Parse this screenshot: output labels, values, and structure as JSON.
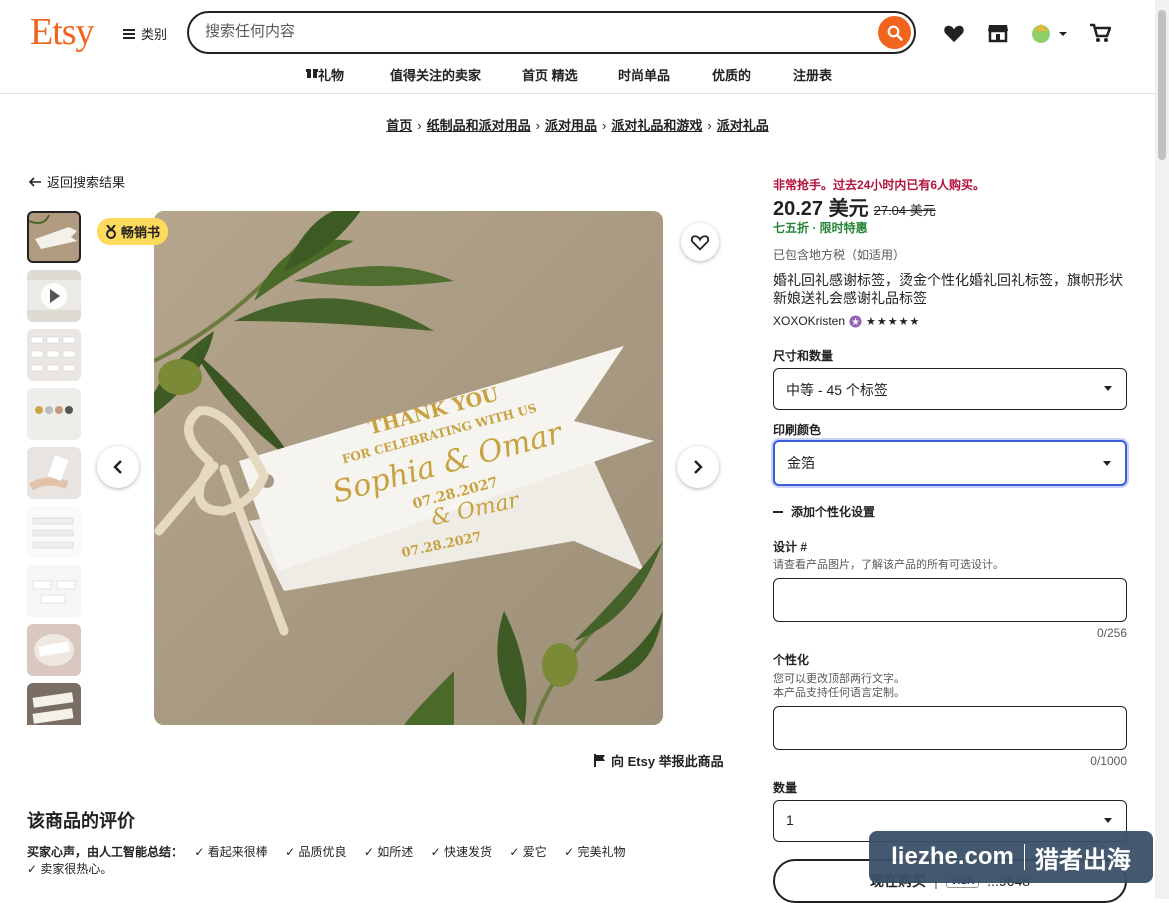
{
  "header": {
    "logo": "Etsy",
    "categories_label": "类别",
    "search_placeholder": "搜索任何内容"
  },
  "nav": {
    "items": [
      "礼物",
      "值得关注的卖家",
      "首页 精选",
      "时尚单品",
      "优质的",
      "注册表"
    ]
  },
  "breadcrumb": [
    "首页",
    "纸制品和派对用品",
    "派对用品",
    "派对礼品和游戏",
    "派对礼品"
  ],
  "back_link": "返回搜索结果",
  "badge": "畅销书",
  "image": {
    "tag_line1": "THANK YOU",
    "tag_line2": "FOR CELEBRATING WITH US",
    "tag_names": "Sophia & Omar",
    "tag_date": "07.28.2027",
    "tag_names_2": "& Omar",
    "tag_date_2": "07.28.2027"
  },
  "report": "向 Etsy 举报此商品",
  "reviews": {
    "title": "该商品的评价",
    "voice_label": "买家心声，由人工智能总结：",
    "tags": [
      "看起来很棒",
      "品质优良",
      "如所述",
      "快速发货",
      "爱它",
      "完美礼物",
      "卖家很热心。"
    ]
  },
  "product": {
    "urgency": "非常抢手。过去24小时内已有6人购买。",
    "price": "20.27 美元",
    "old_price": "27.04 美元",
    "sale": "七五折 · 限时特惠",
    "tax": "已包含地方税（如适用）",
    "title": "婚礼回礼感谢标签，烫金个性化婚礼回礼标签，旗帜形状新娘送礼会感谢礼品标签",
    "seller": "XOXOKristen",
    "rating": "★★★★★",
    "size_label": "尺寸和数量",
    "size_value": "中等 - 45 个标签",
    "color_label": "印刷颜色",
    "color_value": "金箔",
    "add_personalization": "添加个性化设置",
    "design_label": "设计 #",
    "design_help": "请查看产品图片，了解该产品的所有可选设计。",
    "design_count": "0/256",
    "personal_label": "个性化",
    "personal_help1": "您可以更改顶部两行文字。",
    "personal_help2": "本产品支持任何语言定制。",
    "personal_count": "0/1000",
    "qty_label": "数量",
    "qty_value": "1",
    "buy_label": "现在购买",
    "card": "VISA",
    "card_num": "...9648"
  },
  "watermark": {
    "left": "liezhe.com",
    "right": "猎者出海"
  }
}
